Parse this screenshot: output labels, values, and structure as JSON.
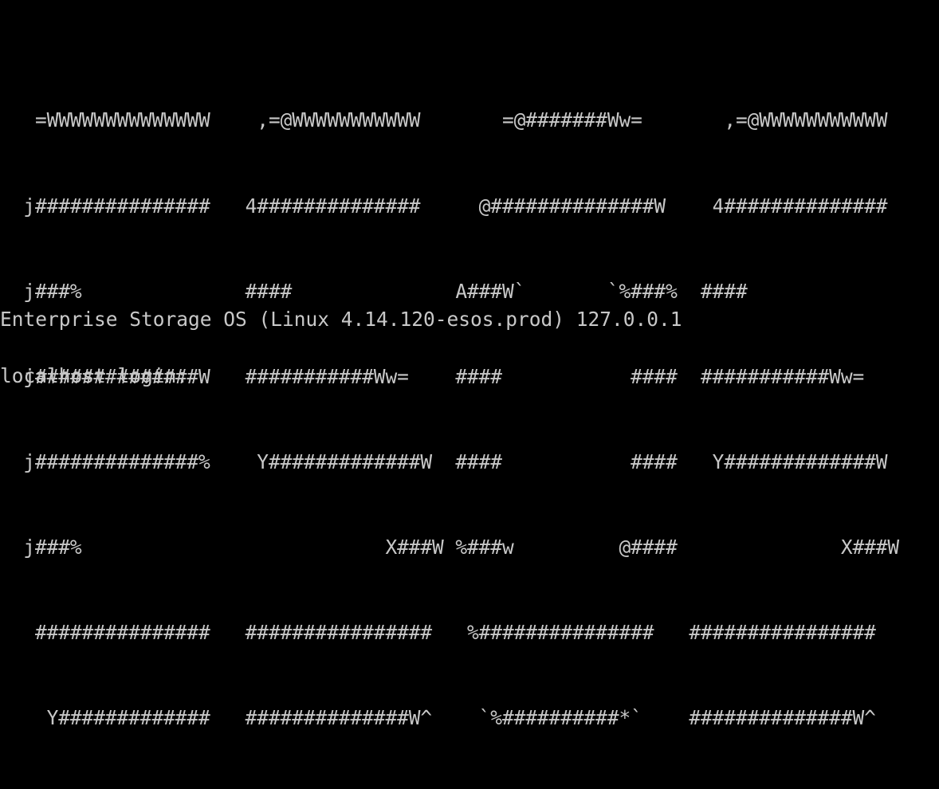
{
  "banner": {
    "lines": [
      "   =WWWWWWWWWWWWWW    ,=@WWWWWWWWWWW       =@#######Ww=       ,=@WWWWWWWWWWW",
      "  j###############   4##############     @##############W    4##############",
      "  j###%              ####              A###W`       `%###%  ####",
      "  j##############W   ###########Ww=    ####           ####  ###########Ww=",
      "  j##############%    Y#############W  ####           ####   Y#############W",
      "  j###%                          X###W %###w         @####              X###W",
      "   ###############   ################   %###############   ################",
      "    Y#############   ##############W^    `%##########*`    ##############W^"
    ]
  },
  "console": {
    "issue": "Enterprise Storage OS (Linux 4.14.120-esos.prod) 127.0.0.1",
    "login_prompt": "localhost login: ",
    "login_value": ""
  }
}
